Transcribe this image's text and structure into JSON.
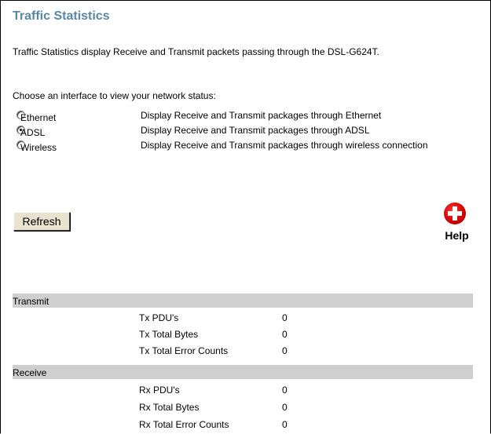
{
  "page": {
    "title": "Traffic Statistics",
    "description": "Traffic Statistics display Receive and Transmit packets passing through the DSL-G624T.",
    "choose_label": "Choose an interface to view your network status:"
  },
  "interfaces": [
    {
      "label": "Ethernet",
      "description": "Display Receive and Transmit packages through Ethernet",
      "selected": false
    },
    {
      "label": "ADSL",
      "description": "Display Receive and Transmit packages through ADSL",
      "selected": true
    },
    {
      "label": "Wireless",
      "description": "Display Receive and Transmit packages through wireless connection",
      "selected": false
    }
  ],
  "refresh_button": {
    "label": "Refresh"
  },
  "help": {
    "label": "Help",
    "icon": "help-plus-icon",
    "color": "#d40000"
  },
  "transmit": {
    "heading": "Transmit",
    "rows": [
      {
        "label": "Tx PDU's",
        "value": "0"
      },
      {
        "label": "Tx Total Bytes",
        "value": "0"
      },
      {
        "label": "Tx Total Error Counts",
        "value": "0"
      }
    ]
  },
  "receive": {
    "heading": "Receive",
    "rows": [
      {
        "label": "Rx PDU's",
        "value": "0"
      },
      {
        "label": "Rx Total Bytes",
        "value": "0"
      },
      {
        "label": "Rx Total Error Counts",
        "value": "0"
      }
    ]
  },
  "colors": {
    "title": "#5a86a3",
    "section_bar": "#cfcfcf",
    "button_face": "#e8e2cf"
  }
}
